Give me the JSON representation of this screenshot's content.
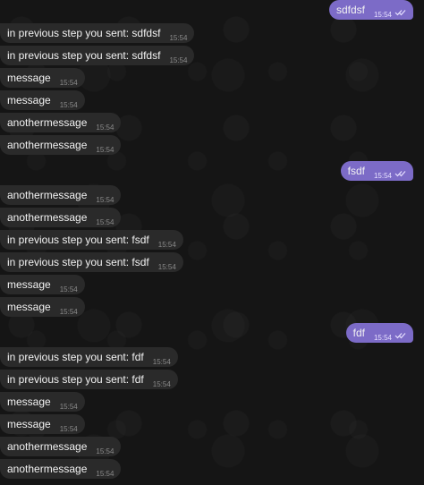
{
  "messages": [
    {
      "side": "out",
      "text": "sdfdsf",
      "time": "15:54"
    },
    {
      "side": "in",
      "text": "in previous step you sent: sdfdsf",
      "time": "15:54"
    },
    {
      "side": "in",
      "text": "in previous step you sent: sdfdsf",
      "time": "15:54"
    },
    {
      "side": "in",
      "text": "message",
      "time": "15:54"
    },
    {
      "side": "in",
      "text": "message",
      "time": "15:54"
    },
    {
      "side": "in",
      "text": "anothermessage",
      "time": "15:54"
    },
    {
      "side": "in",
      "text": "anothermessage",
      "time": "15:54"
    },
    {
      "side": "out",
      "text": "fsdf",
      "time": "15:54"
    },
    {
      "side": "in",
      "text": "anothermessage",
      "time": "15:54"
    },
    {
      "side": "in",
      "text": "anothermessage",
      "time": "15:54"
    },
    {
      "side": "in",
      "text": "in previous step you sent: fsdf",
      "time": "15:54"
    },
    {
      "side": "in",
      "text": "in previous step you sent: fsdf",
      "time": "15:54"
    },
    {
      "side": "in",
      "text": "message",
      "time": "15:54"
    },
    {
      "side": "in",
      "text": "message",
      "time": "15:54"
    },
    {
      "side": "out",
      "text": "fdf",
      "time": "15:54"
    },
    {
      "side": "in",
      "text": "in previous step you sent: fdf",
      "time": "15:54"
    },
    {
      "side": "in",
      "text": "in previous step you sent: fdf",
      "time": "15:54"
    },
    {
      "side": "in",
      "text": "message",
      "time": "15:54"
    },
    {
      "side": "in",
      "text": "message",
      "time": "15:54"
    },
    {
      "side": "in",
      "text": "anothermessage",
      "time": "15:54"
    },
    {
      "side": "in",
      "text": "anothermessage",
      "time": "15:54"
    }
  ],
  "colors": {
    "background": "#151515",
    "incoming_bubble": "#2a2a2a",
    "outgoing_bubble": "#7c6bc7"
  },
  "icons": {
    "read_status": "double-check-icon"
  }
}
